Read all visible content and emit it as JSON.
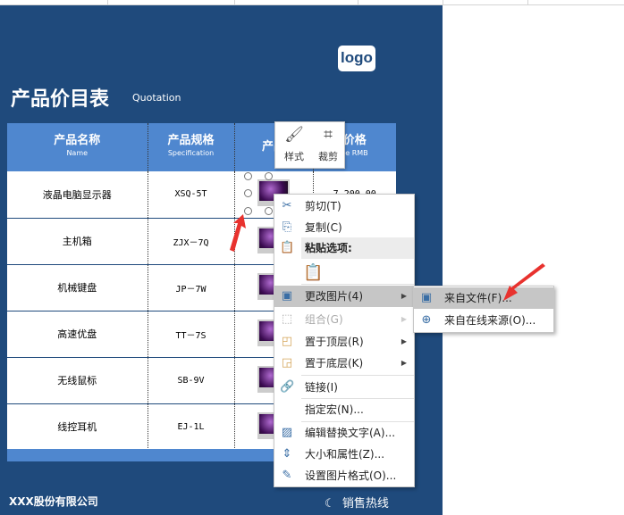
{
  "sheet": {
    "title": "产品价目表",
    "subtitle": "Quotation",
    "logo": "logo",
    "company": "XXX股份有限公司",
    "hotline": "销售热线"
  },
  "table": {
    "headers": [
      {
        "cn": "产品名称",
        "en": "Name"
      },
      {
        "cn": "产品规格",
        "en": "Specification"
      },
      {
        "cn": "产品",
        "en": ""
      },
      {
        "cn": "价格",
        "en": "ce RMB"
      }
    ],
    "rows": [
      {
        "name": "液晶电脑显示器",
        "spec": "XSQ-5T",
        "price": "7,200.00"
      },
      {
        "name": "主机箱",
        "spec": "ZJX－7Q",
        "price": ""
      },
      {
        "name": "机械键盘",
        "spec": "JP－7W",
        "price": ""
      },
      {
        "name": "高速优盘",
        "spec": "TT－7S",
        "price": ""
      },
      {
        "name": "无线鼠标",
        "spec": "SB-9V",
        "price": ""
      },
      {
        "name": "线控耳机",
        "spec": "EJ-1L",
        "price": ""
      }
    ]
  },
  "mini_toolbar": {
    "style": "样式",
    "crop": "裁剪"
  },
  "context_menu": {
    "items": [
      "剪切(T)",
      "复制(C)",
      "粘贴选项:",
      "更改图片(4)",
      "组合(G)",
      "置于顶层(R)",
      "置于底层(K)",
      "链接(I)",
      "指定宏(N)...",
      "编辑替换文字(A)...",
      "大小和属性(Z)...",
      "设置图片格式(O)..."
    ]
  },
  "submenu": {
    "items": [
      "来自文件(F)...",
      "来自在线来源(O)..."
    ]
  },
  "colors": {
    "panel": "#1f4a7c",
    "header": "#4f87cf",
    "arrow": "#e8322e"
  }
}
